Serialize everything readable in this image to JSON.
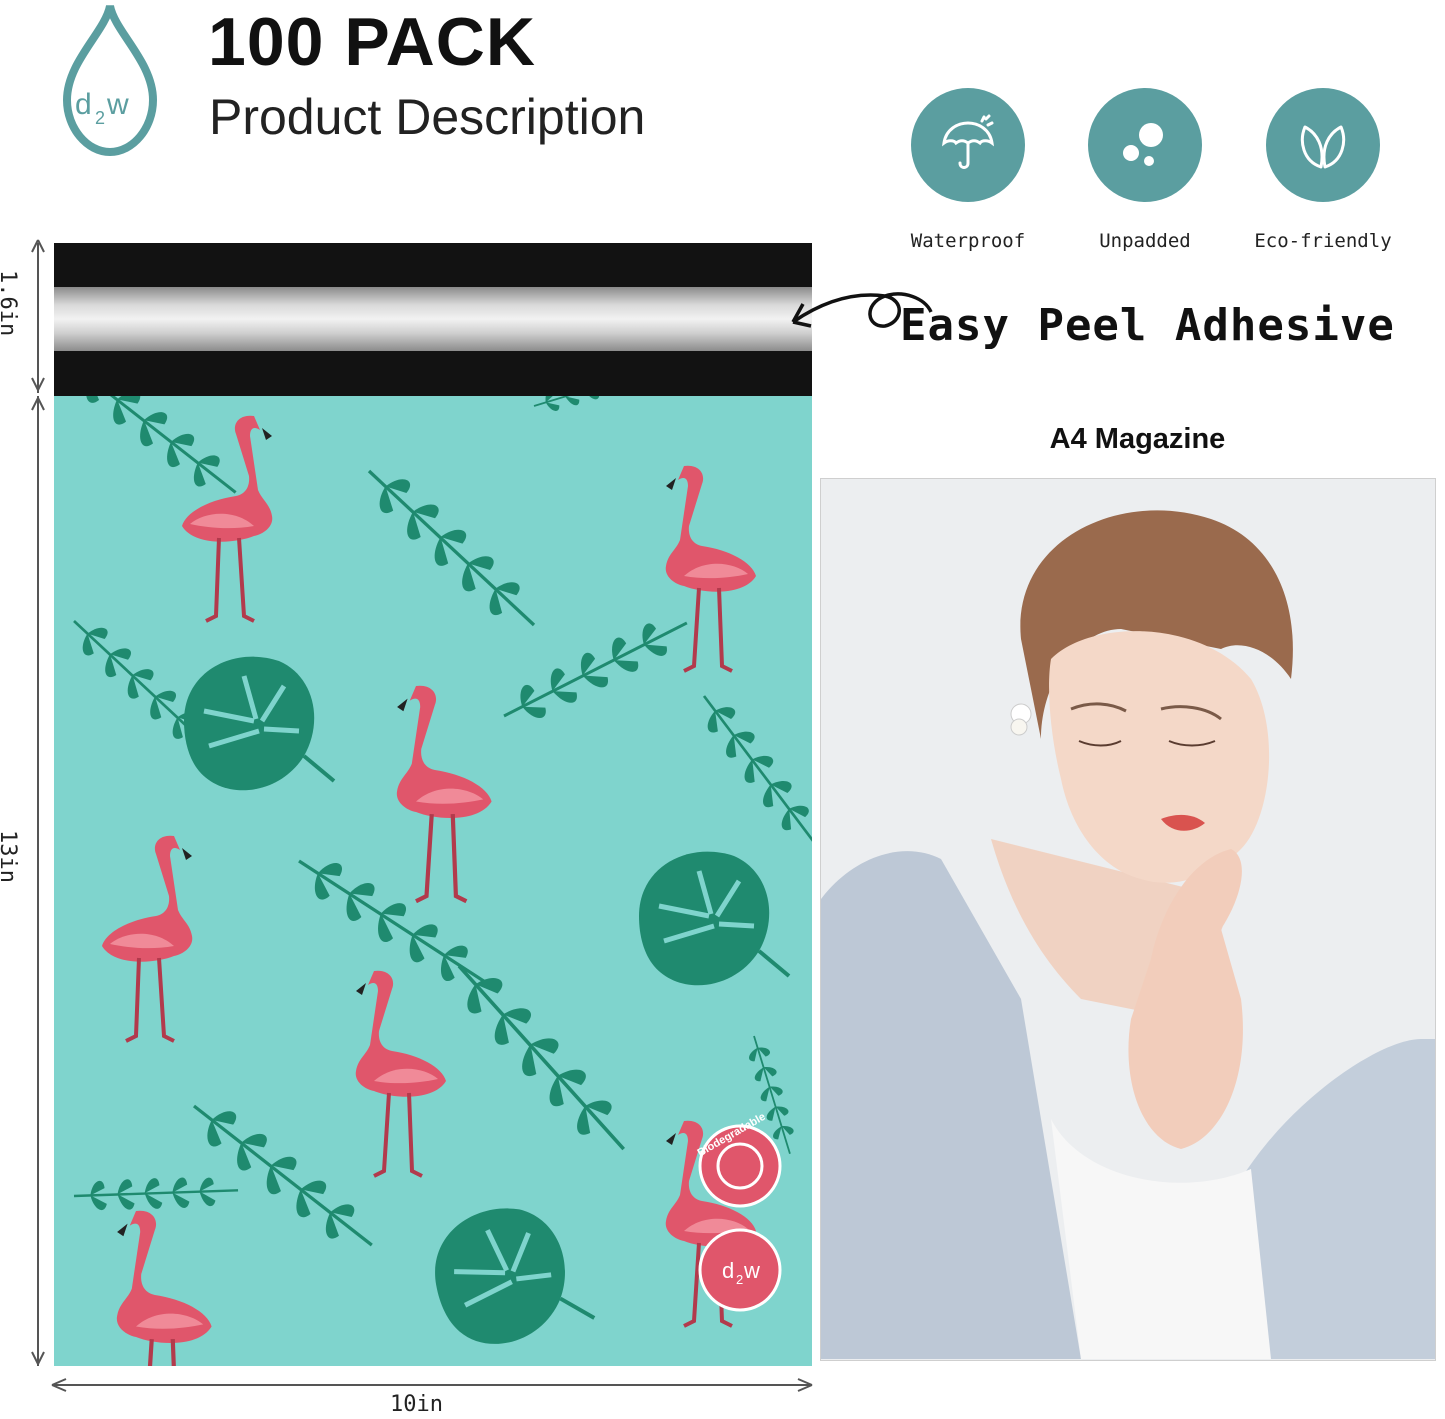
{
  "logo": {
    "text_main": "d",
    "text_sub": "2",
    "text_end": "w"
  },
  "header": {
    "title": "100 PACK",
    "subtitle": "Product Description"
  },
  "features": [
    {
      "icon": "umbrella-icon",
      "label": "Waterproof"
    },
    {
      "icon": "bubbles-icon",
      "label": "Unpadded"
    },
    {
      "icon": "leaf-icon",
      "label": "Eco-friendly"
    }
  ],
  "mailer": {
    "flap_height": "1.6in",
    "body_height": "13in",
    "width": "10in",
    "stamp_text": "Biodegradable"
  },
  "callout": "Easy Peel Adhesive",
  "magazine": {
    "label": "A4 Magazine"
  },
  "colors": {
    "teal": "#5b9ea0",
    "mailer_bg": "#7fd4cd",
    "flamingo": "#e0566b",
    "leaf": "#1f8a6f"
  }
}
